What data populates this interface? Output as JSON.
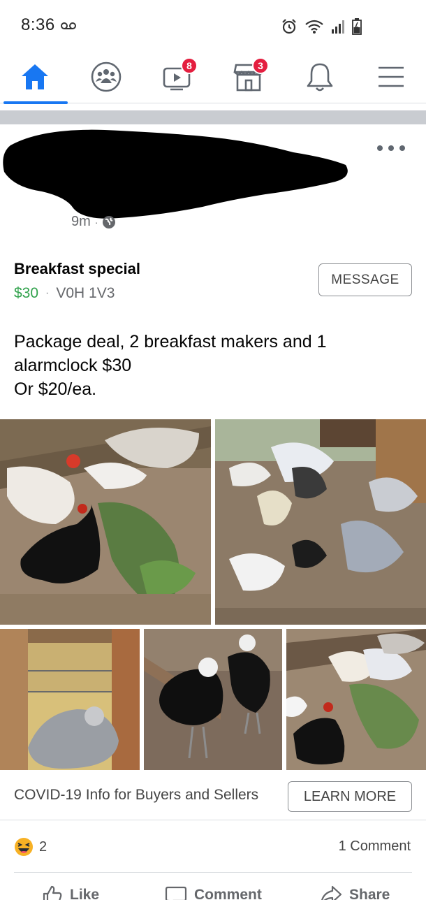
{
  "status_bar": {
    "time": "8:36",
    "icons": [
      "voicemail-icon",
      "alarm-icon",
      "wifi-icon",
      "signal-icon",
      "battery-icon"
    ]
  },
  "nav": {
    "items": [
      {
        "name": "home",
        "icon": "home-icon",
        "active": true,
        "badge": ""
      },
      {
        "name": "groups",
        "icon": "groups-icon",
        "active": false,
        "badge": ""
      },
      {
        "name": "watch",
        "icon": "watch-icon",
        "active": false,
        "badge": "8"
      },
      {
        "name": "marketplace",
        "icon": "marketplace-icon",
        "active": false,
        "badge": "3"
      },
      {
        "name": "notifications",
        "icon": "bell-icon",
        "active": false,
        "badge": ""
      },
      {
        "name": "menu",
        "icon": "hamburger-icon",
        "active": false,
        "badge": ""
      }
    ]
  },
  "post": {
    "time": "9m",
    "visibility_icon": "globe-icon",
    "listing_title": "Breakfast special",
    "price": "$30",
    "separator": "·",
    "location": "V0H 1V3",
    "message_label": "MESSAGE",
    "description_lines": [
      "Package deal, 2 breakfast makers and 1",
      "alarmclock $30",
      "Or $20/ea."
    ]
  },
  "covid": {
    "text": "COVID-19 Info for Buyers and Sellers",
    "button_label": "LEARN MORE"
  },
  "reactions": {
    "emoji": "haha-icon",
    "count": "2",
    "comments": "1 Comment"
  },
  "actions": {
    "like": "Like",
    "comment": "Comment",
    "share": "Share"
  },
  "colors": {
    "accent": "#1877f2",
    "badge": "#e41e3f",
    "price": "#31a24c",
    "muted": "#65676b"
  }
}
